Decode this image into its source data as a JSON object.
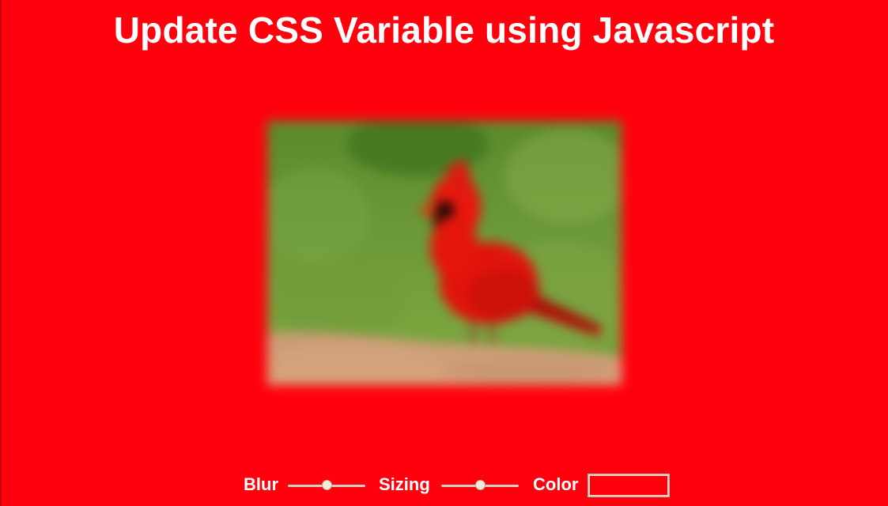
{
  "page": {
    "title": "Update CSS Variable using Javascript",
    "background_color": "#ff000d"
  },
  "image": {
    "subject_icon": "cardinal-bird-photo",
    "blur_state": "blurred"
  },
  "controls": {
    "blur": {
      "label": "Blur",
      "value_fraction": 0.5
    },
    "sizing": {
      "label": "Sizing",
      "value_fraction": 0.5
    },
    "color": {
      "label": "Color",
      "value": "#ff000d"
    }
  }
}
